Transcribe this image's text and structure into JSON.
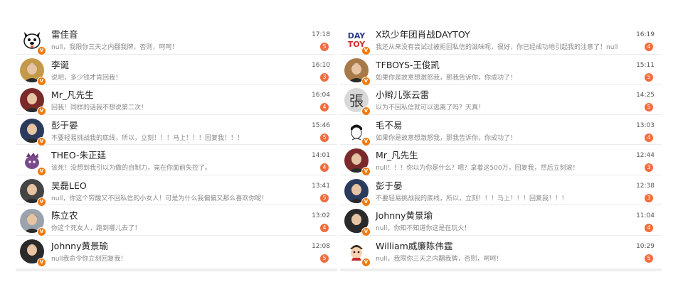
{
  "left_list": [
    {
      "name": "雷佳音",
      "message": "null，我限你三天之内翻我牌，否则，呵呵！",
      "time": "17:18",
      "count": "5",
      "avatar": "bulldog-icon",
      "avatar_bg": "#ffffff"
    },
    {
      "name": "李诞",
      "message": "说吧，多少钱才肯回我！",
      "time": "16:10",
      "count": "3",
      "avatar": "person-avatar",
      "avatar_bg": "#c49a4a"
    },
    {
      "name": "Mr_凡先生",
      "message": "回我！同样的话我不想说第二次！",
      "time": "16:04",
      "count": "4",
      "avatar": "person-avatar",
      "avatar_bg": "#7a2a2a"
    },
    {
      "name": "彭于晏",
      "message": "不要轻易挑战我的底线，所以，立刻！！！马上！！！回复我！！！",
      "time": "15:46",
      "count": "5",
      "avatar": "person-avatar",
      "avatar_bg": "#2b3b5e"
    },
    {
      "name": "THEO-朱正廷",
      "message": "该死！没想到我引以为傲的自制力，竟在你面前失控了。",
      "time": "14:01",
      "count": "4",
      "avatar": "purple-creature-icon",
      "avatar_bg": "#ffffff"
    },
    {
      "name": "吴磊LEO",
      "message": "null，你这个穷酸又不回私信的小女人！可是为什么我偏偏又那么喜欢你呢！",
      "time": "13:41",
      "count": "5",
      "avatar": "person-avatar",
      "avatar_bg": "#444444"
    },
    {
      "name": "陈立农",
      "message": "你这个死女人，跑到哪儿去了！",
      "time": "13:02",
      "count": "4",
      "avatar": "person-avatar",
      "avatar_bg": "#9aa3ad"
    },
    {
      "name": "Johnny黄景瑜",
      "message": "null我命令你立刻回复我！",
      "time": "12:08",
      "count": "5",
      "avatar": "person-avatar",
      "avatar_bg": "#2a2a2a"
    }
  ],
  "right_list": [
    {
      "name": "X玖少年团肖战DAYTOY",
      "message": "我还从来没有尝试过被拒回私信的滋味呢，很好，你已经成功地引起我的注意了！null",
      "time": "16:19",
      "count": "4",
      "avatar": "daytoy-logo",
      "avatar_bg": "#ffffff",
      "logo_top": "DAY",
      "logo_bottom": "TOY"
    },
    {
      "name": "TFBOYS-王俊凯",
      "message": "如果你是故意想激怒我，那我告诉你，你成功了！",
      "time": "15:11",
      "count": "5",
      "avatar": "person-avatar",
      "avatar_bg": "#a87a4a"
    },
    {
      "name": "小辫儿张云雷",
      "message": "以为不回私信就可以逃离了吗？天真！",
      "time": "14:25",
      "count": "5",
      "avatar": "calligraphy-avatar",
      "avatar_bg": "#d8d8d8",
      "glyph": "張"
    },
    {
      "name": "毛不易",
      "message": "如果你是故意想激怒我，那我告诉你，你成功了！",
      "time": "13:03",
      "count": "4",
      "avatar": "sketch-avatar",
      "avatar_bg": "#ffffff"
    },
    {
      "name": "Mr_凡先生",
      "message": "null！！！你以为你是什么？嗯？拿着这500万，回复我，然后立刻滚！",
      "time": "12:44",
      "count": "3",
      "avatar": "person-avatar",
      "avatar_bg": "#7a2a2a"
    },
    {
      "name": "彭于晏",
      "message": "不要轻易挑战我的底线，所以，立刻！！！马上！！！回复我！！！",
      "time": "12:38",
      "count": "3",
      "avatar": "person-avatar",
      "avatar_bg": "#2b3b5e"
    },
    {
      "name": "Johnny黄景瑜",
      "message": "null，你知不知道你这是在玩火！",
      "time": "11:04",
      "count": "4",
      "avatar": "person-avatar",
      "avatar_bg": "#2a2a2a"
    },
    {
      "name": "William威廉陈伟霆",
      "message": "null，我限你三天之内翻我牌，否则，呵呵！",
      "time": "10:29",
      "count": "5",
      "avatar": "cartoon-avatar",
      "avatar_bg": "#ffffff"
    }
  ],
  "verified_badge": "V",
  "colors": {
    "badge_orange": "#f07a12",
    "count_red": "#f26d3d",
    "divider": "#ececec"
  }
}
